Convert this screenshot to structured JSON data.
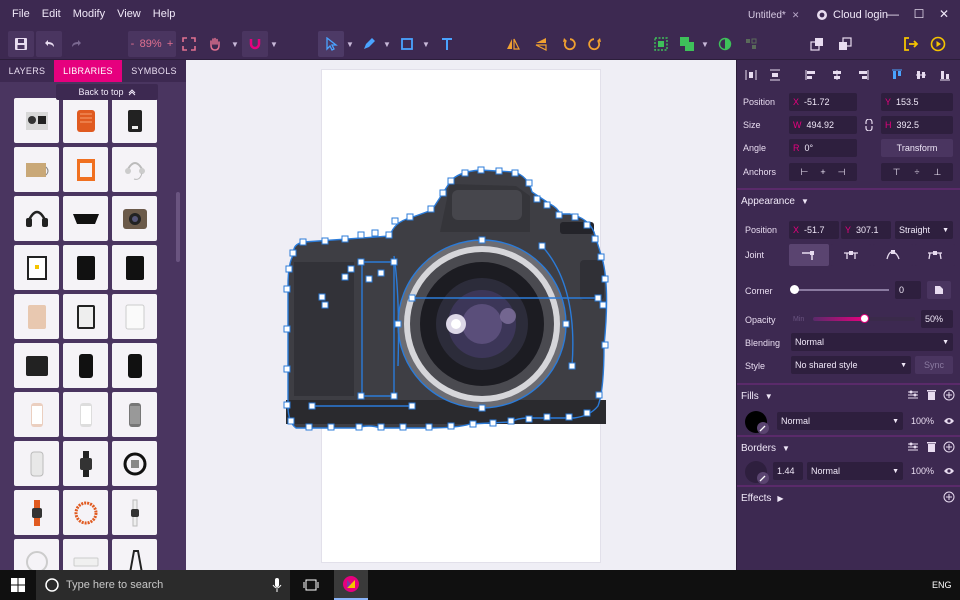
{
  "menu": {
    "items": [
      "File",
      "Edit",
      "Modify",
      "View",
      "Help"
    ]
  },
  "document": {
    "tab_title": "Untitled*",
    "close_glyph": "✕"
  },
  "cloud": {
    "label": "Cloud login"
  },
  "window": {
    "minimize": "—",
    "maximize": "☐",
    "close": "✕"
  },
  "toolbar": {
    "zoom_minus": "-",
    "zoom_value": "89%",
    "zoom_plus": "+"
  },
  "left_panel": {
    "tabs": [
      "LAYERS",
      "LIBRARIES",
      "SYMBOLS"
    ],
    "active_tab": "LIBRARIES",
    "back_to_top": "Back to top"
  },
  "inspector": {
    "position": {
      "label": "Position",
      "x_prefix": "X",
      "x": "-51.72",
      "y_prefix": "Y",
      "y": "153.5"
    },
    "size": {
      "label": "Size",
      "w_prefix": "W",
      "w": "494.92",
      "h_prefix": "H",
      "h": "392.5"
    },
    "angle": {
      "label": "Angle",
      "prefix": "R",
      "value": "0°",
      "transform_button": "Transform"
    },
    "anchors": {
      "label": "Anchors"
    },
    "appearance": {
      "header": "Appearance",
      "position_label": "Position",
      "x_prefix": "X",
      "x": "-51.7",
      "y_prefix": "Y",
      "y": "307.1",
      "line_type": "Straight",
      "joint_label": "Joint",
      "corner_label": "Corner",
      "corner_value": "0",
      "corner_slider": 0,
      "opacity_label": "Opacity",
      "opacity_hint": "Min",
      "opacity_value": "50%",
      "opacity_fraction": 0.5,
      "blending_label": "Blending",
      "blending_value": "Normal",
      "style_label": "Style",
      "style_value": "No shared style",
      "sync_button": "Sync"
    },
    "fills": {
      "header": "Fills",
      "blend": "Normal",
      "opacity": "100%"
    },
    "borders": {
      "header": "Borders",
      "width": "1.44",
      "blend": "Normal",
      "opacity": "100%"
    },
    "effects": {
      "header": "Effects"
    }
  },
  "taskbar": {
    "search_placeholder": "Type here to search",
    "language": "ENG"
  },
  "colors": {
    "accent": "#e6007e",
    "panel": "#3d2951",
    "panel_light": "#4a3560",
    "canvas": "#efeef5",
    "selection": "#2b7bd8"
  }
}
